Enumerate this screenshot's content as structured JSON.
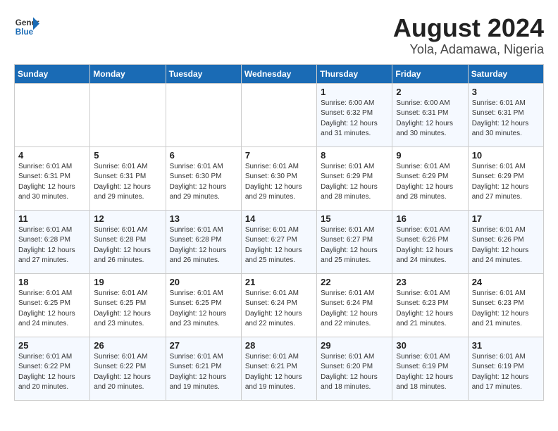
{
  "logo": {
    "line1": "General",
    "line2": "Blue"
  },
  "title": "August 2024",
  "subtitle": "Yola, Adamawa, Nigeria",
  "weekdays": [
    "Sunday",
    "Monday",
    "Tuesday",
    "Wednesday",
    "Thursday",
    "Friday",
    "Saturday"
  ],
  "weeks": [
    [
      {
        "day": "",
        "info": ""
      },
      {
        "day": "",
        "info": ""
      },
      {
        "day": "",
        "info": ""
      },
      {
        "day": "",
        "info": ""
      },
      {
        "day": "1",
        "info": "Sunrise: 6:00 AM\nSunset: 6:32 PM\nDaylight: 12 hours\nand 31 minutes."
      },
      {
        "day": "2",
        "info": "Sunrise: 6:00 AM\nSunset: 6:31 PM\nDaylight: 12 hours\nand 30 minutes."
      },
      {
        "day": "3",
        "info": "Sunrise: 6:01 AM\nSunset: 6:31 PM\nDaylight: 12 hours\nand 30 minutes."
      }
    ],
    [
      {
        "day": "4",
        "info": "Sunrise: 6:01 AM\nSunset: 6:31 PM\nDaylight: 12 hours\nand 30 minutes."
      },
      {
        "day": "5",
        "info": "Sunrise: 6:01 AM\nSunset: 6:31 PM\nDaylight: 12 hours\nand 29 minutes."
      },
      {
        "day": "6",
        "info": "Sunrise: 6:01 AM\nSunset: 6:30 PM\nDaylight: 12 hours\nand 29 minutes."
      },
      {
        "day": "7",
        "info": "Sunrise: 6:01 AM\nSunset: 6:30 PM\nDaylight: 12 hours\nand 29 minutes."
      },
      {
        "day": "8",
        "info": "Sunrise: 6:01 AM\nSunset: 6:29 PM\nDaylight: 12 hours\nand 28 minutes."
      },
      {
        "day": "9",
        "info": "Sunrise: 6:01 AM\nSunset: 6:29 PM\nDaylight: 12 hours\nand 28 minutes."
      },
      {
        "day": "10",
        "info": "Sunrise: 6:01 AM\nSunset: 6:29 PM\nDaylight: 12 hours\nand 27 minutes."
      }
    ],
    [
      {
        "day": "11",
        "info": "Sunrise: 6:01 AM\nSunset: 6:28 PM\nDaylight: 12 hours\nand 27 minutes."
      },
      {
        "day": "12",
        "info": "Sunrise: 6:01 AM\nSunset: 6:28 PM\nDaylight: 12 hours\nand 26 minutes."
      },
      {
        "day": "13",
        "info": "Sunrise: 6:01 AM\nSunset: 6:28 PM\nDaylight: 12 hours\nand 26 minutes."
      },
      {
        "day": "14",
        "info": "Sunrise: 6:01 AM\nSunset: 6:27 PM\nDaylight: 12 hours\nand 25 minutes."
      },
      {
        "day": "15",
        "info": "Sunrise: 6:01 AM\nSunset: 6:27 PM\nDaylight: 12 hours\nand 25 minutes."
      },
      {
        "day": "16",
        "info": "Sunrise: 6:01 AM\nSunset: 6:26 PM\nDaylight: 12 hours\nand 24 minutes."
      },
      {
        "day": "17",
        "info": "Sunrise: 6:01 AM\nSunset: 6:26 PM\nDaylight: 12 hours\nand 24 minutes."
      }
    ],
    [
      {
        "day": "18",
        "info": "Sunrise: 6:01 AM\nSunset: 6:25 PM\nDaylight: 12 hours\nand 24 minutes."
      },
      {
        "day": "19",
        "info": "Sunrise: 6:01 AM\nSunset: 6:25 PM\nDaylight: 12 hours\nand 23 minutes."
      },
      {
        "day": "20",
        "info": "Sunrise: 6:01 AM\nSunset: 6:25 PM\nDaylight: 12 hours\nand 23 minutes."
      },
      {
        "day": "21",
        "info": "Sunrise: 6:01 AM\nSunset: 6:24 PM\nDaylight: 12 hours\nand 22 minutes."
      },
      {
        "day": "22",
        "info": "Sunrise: 6:01 AM\nSunset: 6:24 PM\nDaylight: 12 hours\nand 22 minutes."
      },
      {
        "day": "23",
        "info": "Sunrise: 6:01 AM\nSunset: 6:23 PM\nDaylight: 12 hours\nand 21 minutes."
      },
      {
        "day": "24",
        "info": "Sunrise: 6:01 AM\nSunset: 6:23 PM\nDaylight: 12 hours\nand 21 minutes."
      }
    ],
    [
      {
        "day": "25",
        "info": "Sunrise: 6:01 AM\nSunset: 6:22 PM\nDaylight: 12 hours\nand 20 minutes."
      },
      {
        "day": "26",
        "info": "Sunrise: 6:01 AM\nSunset: 6:22 PM\nDaylight: 12 hours\nand 20 minutes."
      },
      {
        "day": "27",
        "info": "Sunrise: 6:01 AM\nSunset: 6:21 PM\nDaylight: 12 hours\nand 19 minutes."
      },
      {
        "day": "28",
        "info": "Sunrise: 6:01 AM\nSunset: 6:21 PM\nDaylight: 12 hours\nand 19 minutes."
      },
      {
        "day": "29",
        "info": "Sunrise: 6:01 AM\nSunset: 6:20 PM\nDaylight: 12 hours\nand 18 minutes."
      },
      {
        "day": "30",
        "info": "Sunrise: 6:01 AM\nSunset: 6:19 PM\nDaylight: 12 hours\nand 18 minutes."
      },
      {
        "day": "31",
        "info": "Sunrise: 6:01 AM\nSunset: 6:19 PM\nDaylight: 12 hours\nand 17 minutes."
      }
    ]
  ]
}
